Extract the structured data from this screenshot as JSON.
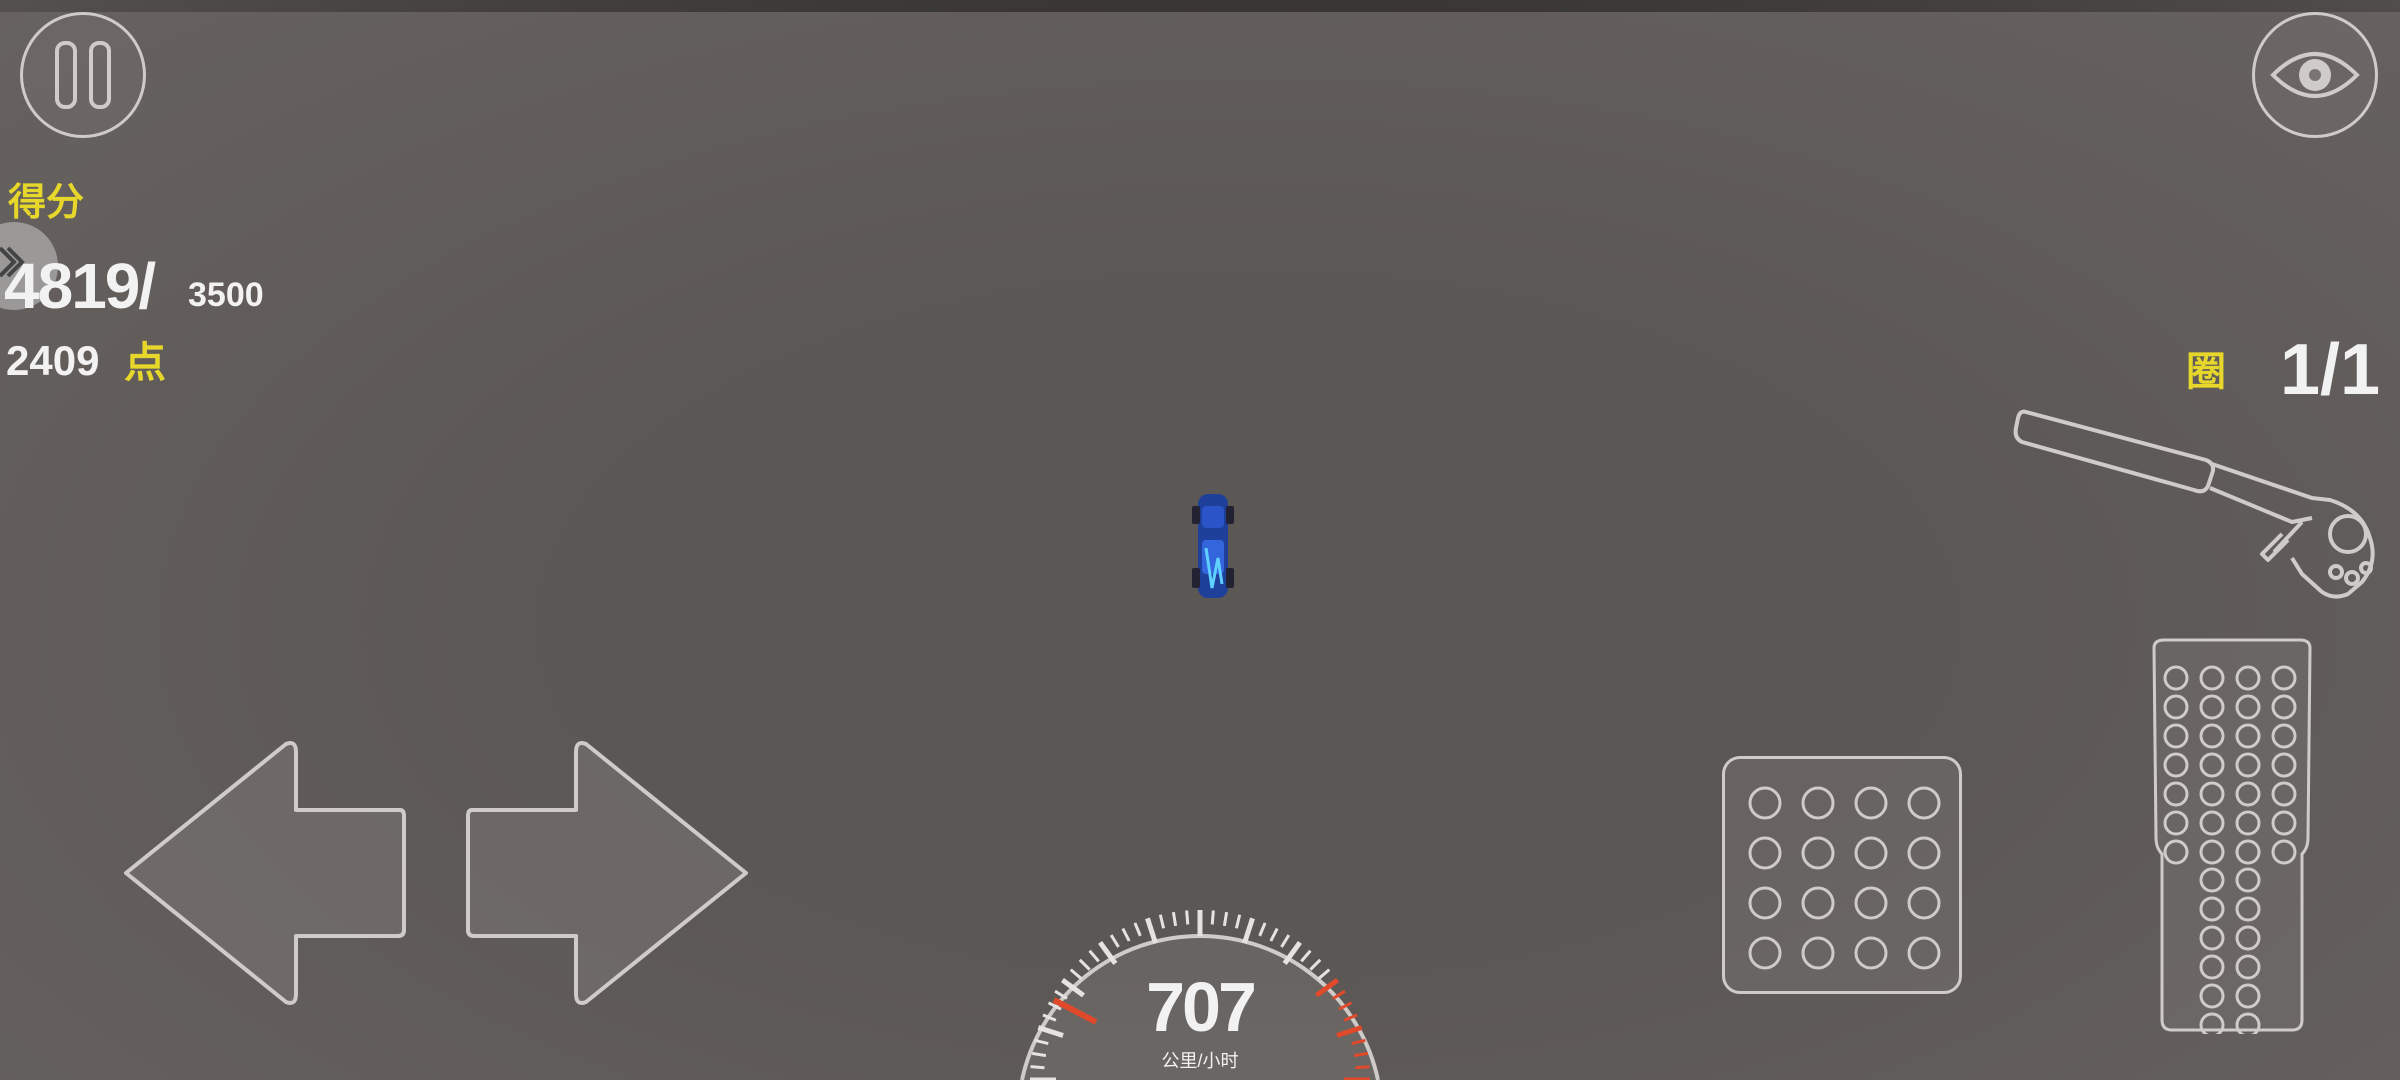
{
  "hud": {
    "score_label": "得分",
    "score_value": "4819/",
    "score_target": "3500",
    "points_value": "2409",
    "points_unit": "点",
    "lap_label": "圈",
    "lap_value": "1/1"
  },
  "speedometer": {
    "speed": "707",
    "unit": "公里/小时"
  },
  "controls": {
    "pause": "pause-icon",
    "camera": "eye-icon",
    "left": "arrow-left-icon",
    "right": "arrow-right-icon",
    "handbrake": "handbrake-icon",
    "brake": "brake-pedal-icon",
    "gas": "gas-pedal-icon"
  },
  "colors": {
    "ground": "#5b5755",
    "outline": "#cfcbc9",
    "label_yellow": "#e6d72a",
    "redline": "#e04a2a",
    "car_blue": "#2a54c8"
  }
}
